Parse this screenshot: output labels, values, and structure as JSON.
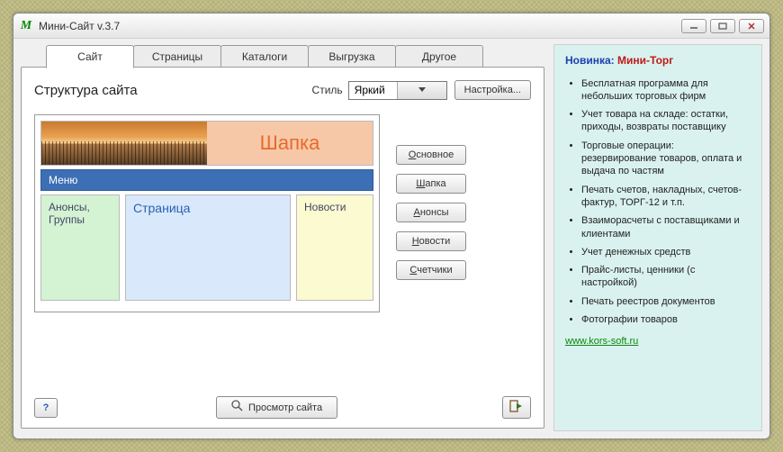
{
  "window": {
    "title": "Мини-Сайт v.3.7",
    "icon_letter": "M"
  },
  "tabs": [
    {
      "label": "Сайт"
    },
    {
      "label": "Страницы"
    },
    {
      "label": "Каталоги"
    },
    {
      "label": "Выгрузка"
    },
    {
      "label": "Другое"
    }
  ],
  "heading": "Структура сайта",
  "style_label": "Стиль",
  "style_value": "Яркий",
  "settings_btn": "Настройка...",
  "preview": {
    "header_label": "Шапка",
    "menu_label": "Меню",
    "col_a": "Анонсы, Группы",
    "col_b": "Страница",
    "col_c": "Новости"
  },
  "side_buttons": {
    "main_pre": "О",
    "main_post": "сновное",
    "header_pre": "Ш",
    "header_post": "апка",
    "announce_pre": "А",
    "announce_post": "нонсы",
    "news_pre": "Н",
    "news_post": "овости",
    "counters_pre": "С",
    "counters_post": "четчики"
  },
  "bottom": {
    "help": "?",
    "preview": "Просмотр сайта"
  },
  "promo": {
    "label": "Новинка: ",
    "product": "Мини-Торг",
    "features": [
      "Бесплатная программа для небольших торговых фирм",
      "Учет товара на складе: остатки, приходы, возвраты поставщику",
      "Торговые операции: резервирование товаров, оплата и выдача по частям",
      "Печать счетов, накладных, счетов-фактур, ТОРГ-12 и т.п.",
      "Взаиморасчеты с поставщиками и клиентами",
      "Учет денежных средств",
      "Прайс-листы, ценники (с настройкой)",
      "Печать реестров документов",
      "Фотографии товаров"
    ],
    "link": "www.kors-soft.ru"
  }
}
